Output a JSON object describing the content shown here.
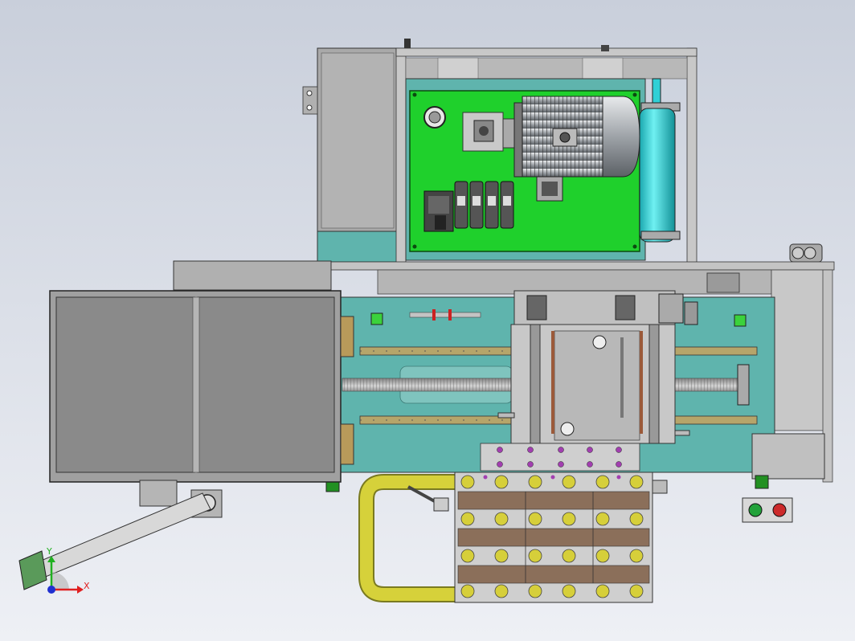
{
  "background": {
    "top": "#c9cfdb",
    "bottom": "#eef0f5"
  },
  "colors": {
    "teal_plate": "#5fb4ad",
    "green_panel": "#1fd02c",
    "frame_grey": "#9a9a9a",
    "guard_grey": "#8a8a8a",
    "motor_silver": "#c8ccd0",
    "cyan_tank": "#2fd0d6",
    "yellow_handle": "#d6d13a",
    "brown_block": "#8b6f5a",
    "button_green": "#23a23a",
    "button_red": "#cc2a2a",
    "purple_bolt": "#a23fb0"
  },
  "triad": {
    "x_label": "X",
    "y_label": "Y",
    "x_color": "#e02020",
    "y_color": "#20b020",
    "z_color": "#2030d0"
  }
}
